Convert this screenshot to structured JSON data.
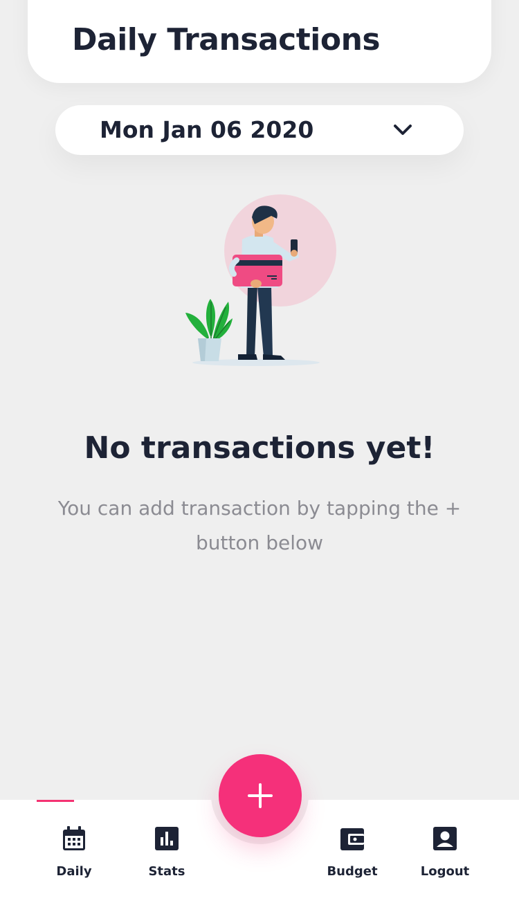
{
  "header": {
    "title": "Daily Transactions"
  },
  "date_selector": {
    "value": "Mon Jan 06 2020",
    "icon": "chevron-down-icon"
  },
  "empty_state": {
    "illustration": "person-holding-credit-card-illustration",
    "title": "No transactions yet!",
    "description": "You can add transaction by tapping the + button below"
  },
  "fab": {
    "icon": "plus-icon",
    "color": "#f5307a"
  },
  "bottom_nav": {
    "active": "Daily",
    "accent_color": "#f43372",
    "items": [
      {
        "label": "Daily",
        "icon": "calendar-icon"
      },
      {
        "label": "Stats",
        "icon": "bar-chart-icon"
      },
      {
        "label": "Budget",
        "icon": "wallet-icon"
      },
      {
        "label": "Logout",
        "icon": "account-icon"
      }
    ]
  },
  "colors": {
    "background": "#efefef",
    "card": "#ffffff",
    "text_primary": "#1d2335",
    "text_secondary": "#8b8b92",
    "accent": "#f5307a"
  }
}
